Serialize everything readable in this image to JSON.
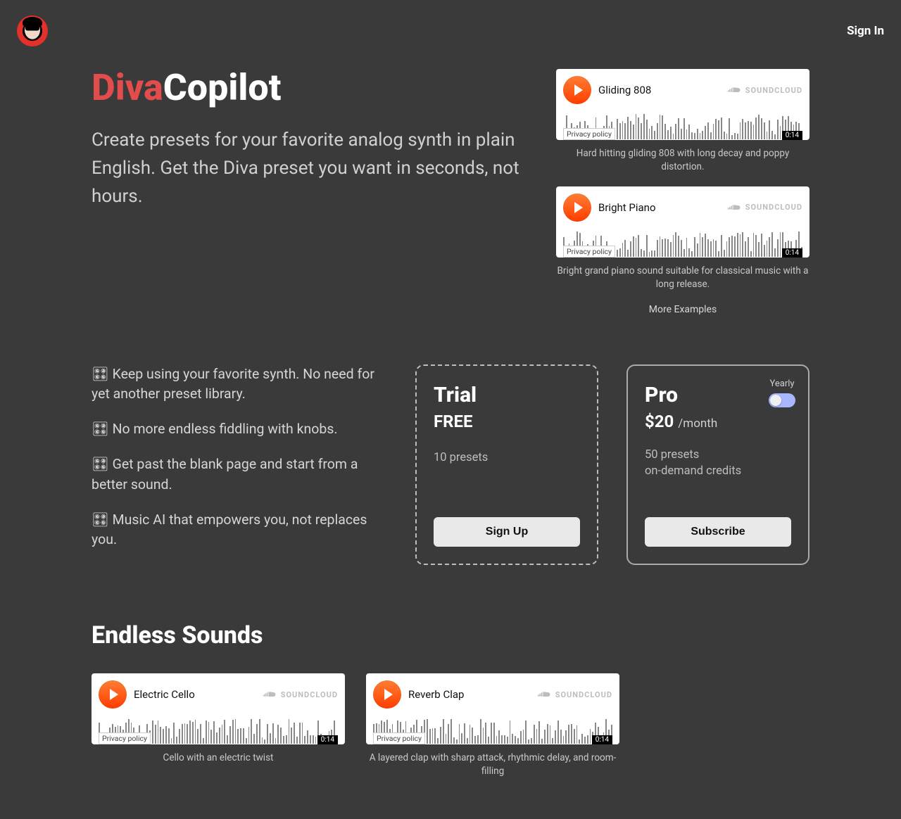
{
  "nav": {
    "signin": "Sign In"
  },
  "hero": {
    "title_accent": "Diva",
    "title_rest": "Copilot",
    "subtitle": "Create presets for your favorite analog synth in plain English. Get the Diva preset you want in seconds, not hours."
  },
  "player_common": {
    "brand": "SOUNDCLOUD",
    "privacy": "Privacy policy",
    "duration": "0:14"
  },
  "examples": [
    {
      "title": "Gliding 808",
      "caption": "Hard hitting gliding 808 with long decay and poppy distortion."
    },
    {
      "title": "Bright Piano",
      "caption": "Bright grand piano sound suitable for classical music with a long release."
    }
  ],
  "more_examples": "More Examples",
  "benefits": [
    "🎛 Keep using your favorite synth. No need for yet another preset library.",
    "🎛 No more endless fiddling with knobs.",
    "🎛 Get past the blank page and start from a better sound.",
    "🎛 Music AI that empowers you, not replaces you."
  ],
  "plans": {
    "trial": {
      "name": "Trial",
      "price_label": "FREE",
      "note": "10 presets",
      "cta": "Sign Up"
    },
    "pro": {
      "name": "Pro",
      "amount": "$20",
      "per": "/month",
      "note1": "50 presets",
      "note2": "on-demand credits",
      "cta": "Subscribe",
      "yearly_label": "Yearly"
    }
  },
  "endless": {
    "heading": "Endless Sounds",
    "items": [
      {
        "title": "Electric Cello",
        "caption": "Cello with an electric twist"
      },
      {
        "title": "Reverb Clap",
        "caption": "A layered clap with sharp attack, rhythmic delay, and room-filling"
      }
    ]
  }
}
